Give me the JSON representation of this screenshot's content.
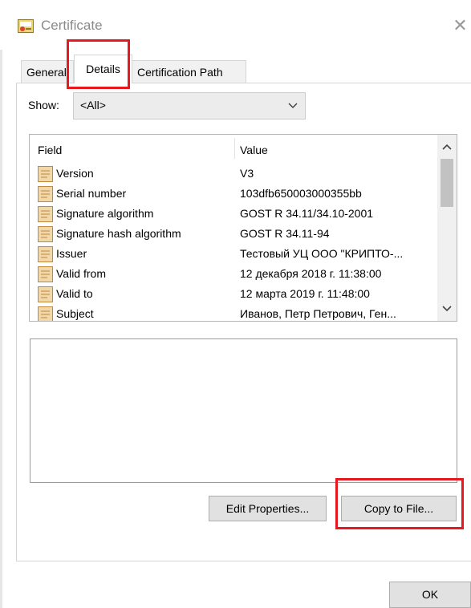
{
  "window": {
    "title": "Certificate",
    "close_glyph": "✕"
  },
  "tabs": [
    {
      "label": "General",
      "active": false
    },
    {
      "label": "Details",
      "active": true
    },
    {
      "label": "Certification Path",
      "active": false
    }
  ],
  "show": {
    "label": "Show:",
    "selected": "<All>"
  },
  "list": {
    "columns": [
      "Field",
      "Value"
    ],
    "rows": [
      {
        "field": "Version",
        "value": "V3"
      },
      {
        "field": "Serial number",
        "value": "103dfb650003000355bb"
      },
      {
        "field": "Signature algorithm",
        "value": "GOST R 34.11/34.10-2001"
      },
      {
        "field": "Signature hash algorithm",
        "value": "GOST R 34.11-94"
      },
      {
        "field": "Issuer",
        "value": "Тестовый УЦ ООО \"КРИПТО-..."
      },
      {
        "field": "Valid from",
        "value": "12 декабря 2018 г. 11:38:00"
      },
      {
        "field": "Valid to",
        "value": "12 марта 2019 г. 11:48:00"
      },
      {
        "field": "Subject",
        "value": "Иванов, Петр Петрович, Ген..."
      }
    ]
  },
  "buttons": {
    "edit_properties": "Edit Properties...",
    "copy_to_file": "Copy to File...",
    "ok": "OK"
  },
  "icons": {
    "title": "certificate-icon",
    "row": "certificate-field-icon",
    "close": "close-icon",
    "dropdown": "chevron-down-icon",
    "scroll_up": "chevron-up-icon",
    "scroll_down": "chevron-down-icon"
  },
  "colors": {
    "highlight": "#e8191e",
    "panel_border": "#d5d5d5",
    "button_face": "#e1e1e1",
    "title_text": "#8a8a8a"
  }
}
